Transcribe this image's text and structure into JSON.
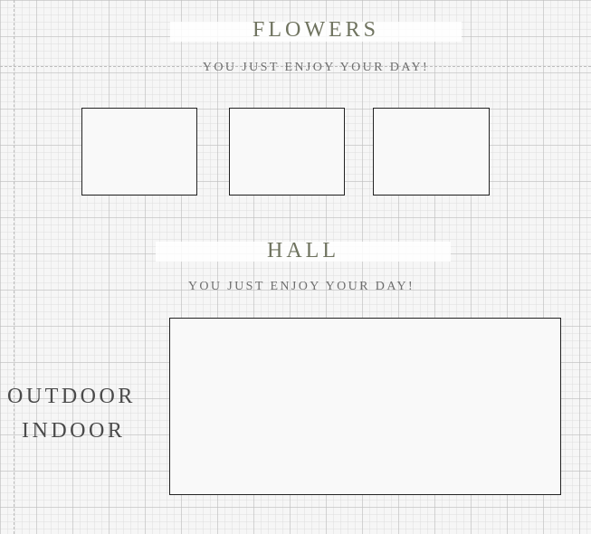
{
  "flowers": {
    "title": "FLOWERS",
    "subtitle": "YOU JUST ENJOY YOUR DAY!"
  },
  "hall": {
    "title": "HALL",
    "subtitle": "YOU JUST ENJOY YOUR DAY!",
    "labels": [
      "OUTDOOR",
      "INDOOR"
    ]
  }
}
